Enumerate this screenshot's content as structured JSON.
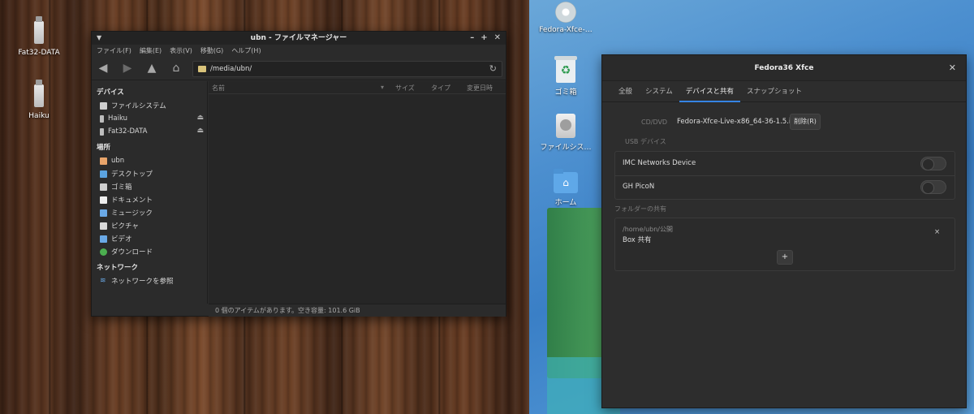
{
  "left_desktop": {
    "icons": [
      {
        "label": "Fat32-DATA"
      },
      {
        "label": "Haiku"
      }
    ]
  },
  "right_desktop": {
    "icons": [
      {
        "label": "Fedora-Xfce-…"
      },
      {
        "label": "ゴミ箱"
      },
      {
        "label": "ファイルシス…"
      },
      {
        "label": "ホーム"
      }
    ]
  },
  "file_manager": {
    "title": "ubn - ファイルマネージャー",
    "menu": [
      "ファイル(F)",
      "編集(E)",
      "表示(V)",
      "移動(G)",
      "ヘルプ(H)"
    ],
    "location": "/media/ubn/",
    "sidebar": {
      "devices_header": "デバイス",
      "devices": [
        {
          "label": "ファイルシステム",
          "icon": "drive-icon"
        },
        {
          "label": "Haiku",
          "icon": "usb-icon",
          "eject": true
        },
        {
          "label": "Fat32-DATA",
          "icon": "usb-icon",
          "eject": true
        }
      ],
      "places_header": "場所",
      "places": [
        {
          "label": "ubn",
          "icon": "home-icon"
        },
        {
          "label": "デスクトップ",
          "icon": "desktop-icon"
        },
        {
          "label": "ゴミ箱",
          "icon": "trash-icon"
        },
        {
          "label": "ドキュメント",
          "icon": "document-icon"
        },
        {
          "label": "ミュージック",
          "icon": "music-icon"
        },
        {
          "label": "ピクチャ",
          "icon": "picture-icon"
        },
        {
          "label": "ビデオ",
          "icon": "video-icon"
        },
        {
          "label": "ダウンロード",
          "icon": "download-icon"
        }
      ],
      "network_header": "ネットワーク",
      "network": [
        {
          "label": "ネットワークを参照",
          "icon": "wifi-icon"
        }
      ]
    },
    "columns": {
      "name": "名前",
      "size": "サイズ",
      "type": "タイプ",
      "modified": "変更日時"
    },
    "status": "0 個のアイテムがあります。空き容量: 101.6 GiB"
  },
  "settings_window": {
    "title": "Fedora36 Xfce",
    "tabs": [
      "全般",
      "システム",
      "デバイスと共有",
      "スナップショット"
    ],
    "active_tab": "デバイスと共有",
    "cd_label": "CD/DVD",
    "cd_value": "Fedora-Xfce-Live-x86_64-36-1.5.iso",
    "remove_button": "削除(R)",
    "usb_header": "USB デバイス",
    "usb_devices": [
      "IMC Networks Device",
      "GH PicoN"
    ],
    "shared_header": "フォルダーの共有",
    "shared_path": "/home/ubn/公開",
    "shared_name": "Box 共有",
    "add_button": "+",
    "remove_share": "×"
  }
}
